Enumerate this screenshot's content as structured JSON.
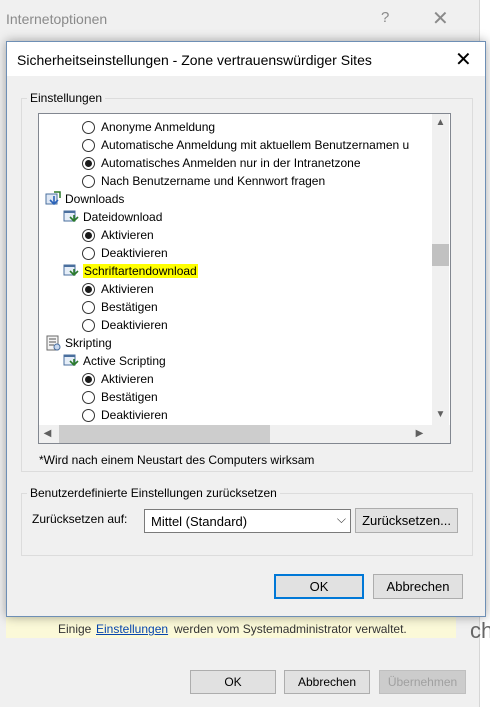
{
  "background_window": {
    "title": "Internetoptionen",
    "help": "?",
    "close": "✕",
    "notice_prefix": "Einige",
    "notice_link": "Einstellungen",
    "notice_suffix": "werden vom Systemadministrator verwaltet.",
    "edge_glyph": "ch",
    "buttons": {
      "ok": "OK",
      "cancel": "Abbrechen",
      "apply": "Übernehmen"
    }
  },
  "dialog": {
    "title": "Sicherheitseinstellungen - Zone vertrauenswürdiger Sites",
    "close": "✕",
    "settings_group_label": "Einstellungen",
    "footnote": "*Wird nach einem Neustart des Computers wirksam",
    "reset_group_label": "Benutzerdefinierte Einstellungen zurücksetzen",
    "reset_to_label": "Zurücksetzen auf:",
    "reset_select_value": "Mittel (Standard)",
    "reset_button": "Zurücksetzen...",
    "ok_button": "OK",
    "cancel_button": "Abbrechen"
  },
  "tree": {
    "items": [
      {
        "type": "radio",
        "label": "Anonyme Anmeldung",
        "checked": false
      },
      {
        "type": "radio",
        "label": "Automatische Anmeldung mit aktuellem Benutzernamen u",
        "checked": false
      },
      {
        "type": "radio",
        "label": "Automatisches Anmelden nur in der Intranetzone",
        "checked": true
      },
      {
        "type": "radio",
        "label": "Nach Benutzername und Kennwort fragen",
        "checked": false
      },
      {
        "type": "category",
        "label": "Downloads",
        "icon": "downloads-category-icon"
      },
      {
        "type": "setting",
        "label": "Dateidownload",
        "icon": "setting-icon"
      },
      {
        "type": "radio",
        "label": "Aktivieren",
        "checked": true
      },
      {
        "type": "radio",
        "label": "Deaktivieren",
        "checked": false
      },
      {
        "type": "setting",
        "label": "Schriftartendownload",
        "icon": "setting-icon",
        "highlighted": true
      },
      {
        "type": "radio",
        "label": "Aktivieren",
        "checked": true
      },
      {
        "type": "radio",
        "label": "Bestätigen",
        "checked": false
      },
      {
        "type": "radio",
        "label": "Deaktivieren",
        "checked": false
      },
      {
        "type": "category",
        "label": "Skripting",
        "icon": "scripting-category-icon"
      },
      {
        "type": "setting",
        "label": "Active Scripting",
        "icon": "setting-icon"
      },
      {
        "type": "radio",
        "label": "Aktivieren",
        "checked": true
      },
      {
        "type": "radio",
        "label": "Bestätigen",
        "checked": false
      },
      {
        "type": "radio",
        "label": "Deaktivieren",
        "checked": false
      }
    ]
  },
  "colors": {
    "highlight": "#ffff00",
    "accent": "#0078d7"
  }
}
